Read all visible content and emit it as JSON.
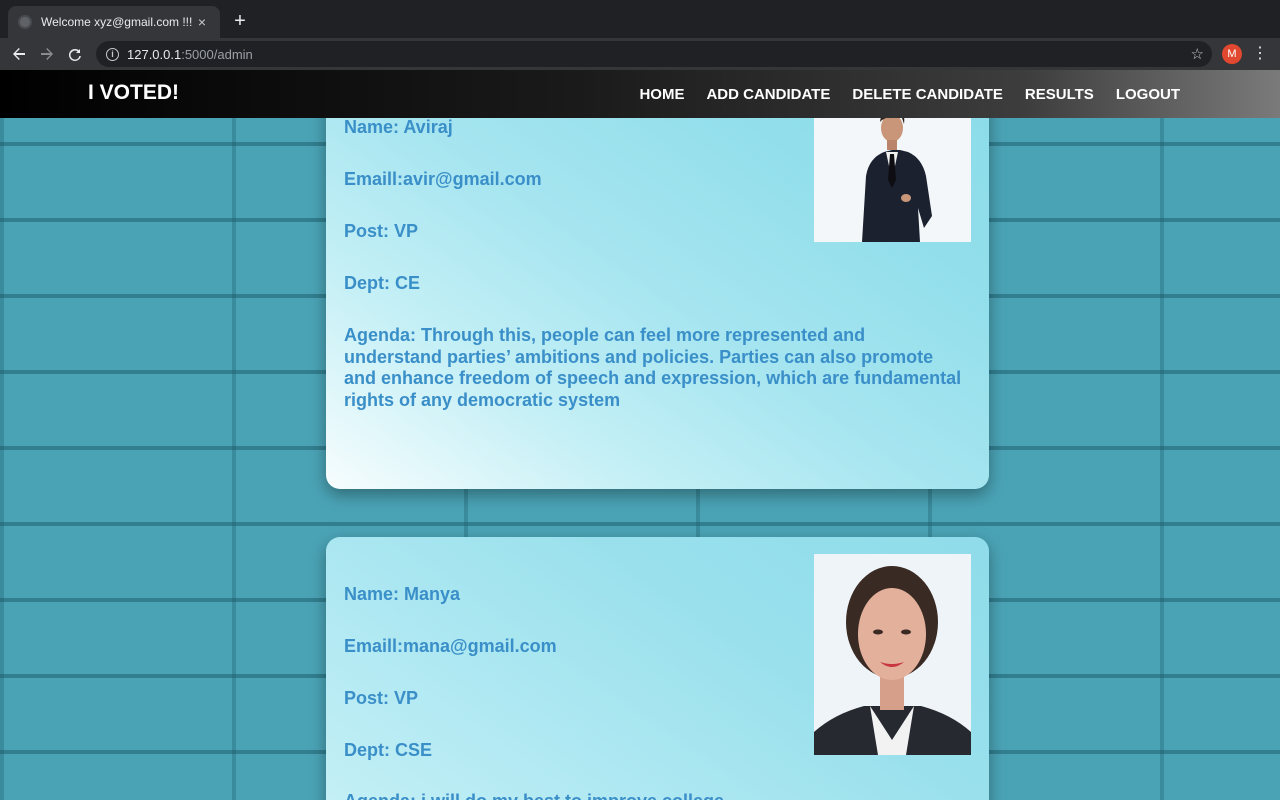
{
  "browser": {
    "tab_title": "Welcome xyz@gmail.com !!!",
    "tab_close": "×",
    "new_tab": "+",
    "url_host": "127.0.0.1",
    "url_path": ":5000/admin",
    "profile_initial": "M"
  },
  "site": {
    "brand": "I VOTED!",
    "nav": [
      "HOME",
      "ADD CANDIDATE",
      "DELETE CANDIDATE",
      "RESULTS",
      "LOGOUT"
    ]
  },
  "candidates": [
    {
      "name": "Name: Aviraj",
      "email": "Emaill:avir@gmail.com",
      "post": "Post: VP",
      "dept": "Dept: CE",
      "agenda": "Agenda: Through this, people can feel more represented and understand parties’ ambitions and policies. Parties can also promote and enhance freedom of speech and expression, which are fundamental rights of any democratic system"
    },
    {
      "name": "Name: Manya",
      "email": "Emaill:mana@gmail.com",
      "post": "Post: VP",
      "dept": "Dept: CSE",
      "agenda": "Agenda: i will do my best to improve college"
    }
  ],
  "colors": {
    "card_text": "#3a8fc8",
    "navbar_start": "#000000",
    "navbar_end": "#7a7a7a",
    "wall": "#4aa3b5"
  }
}
